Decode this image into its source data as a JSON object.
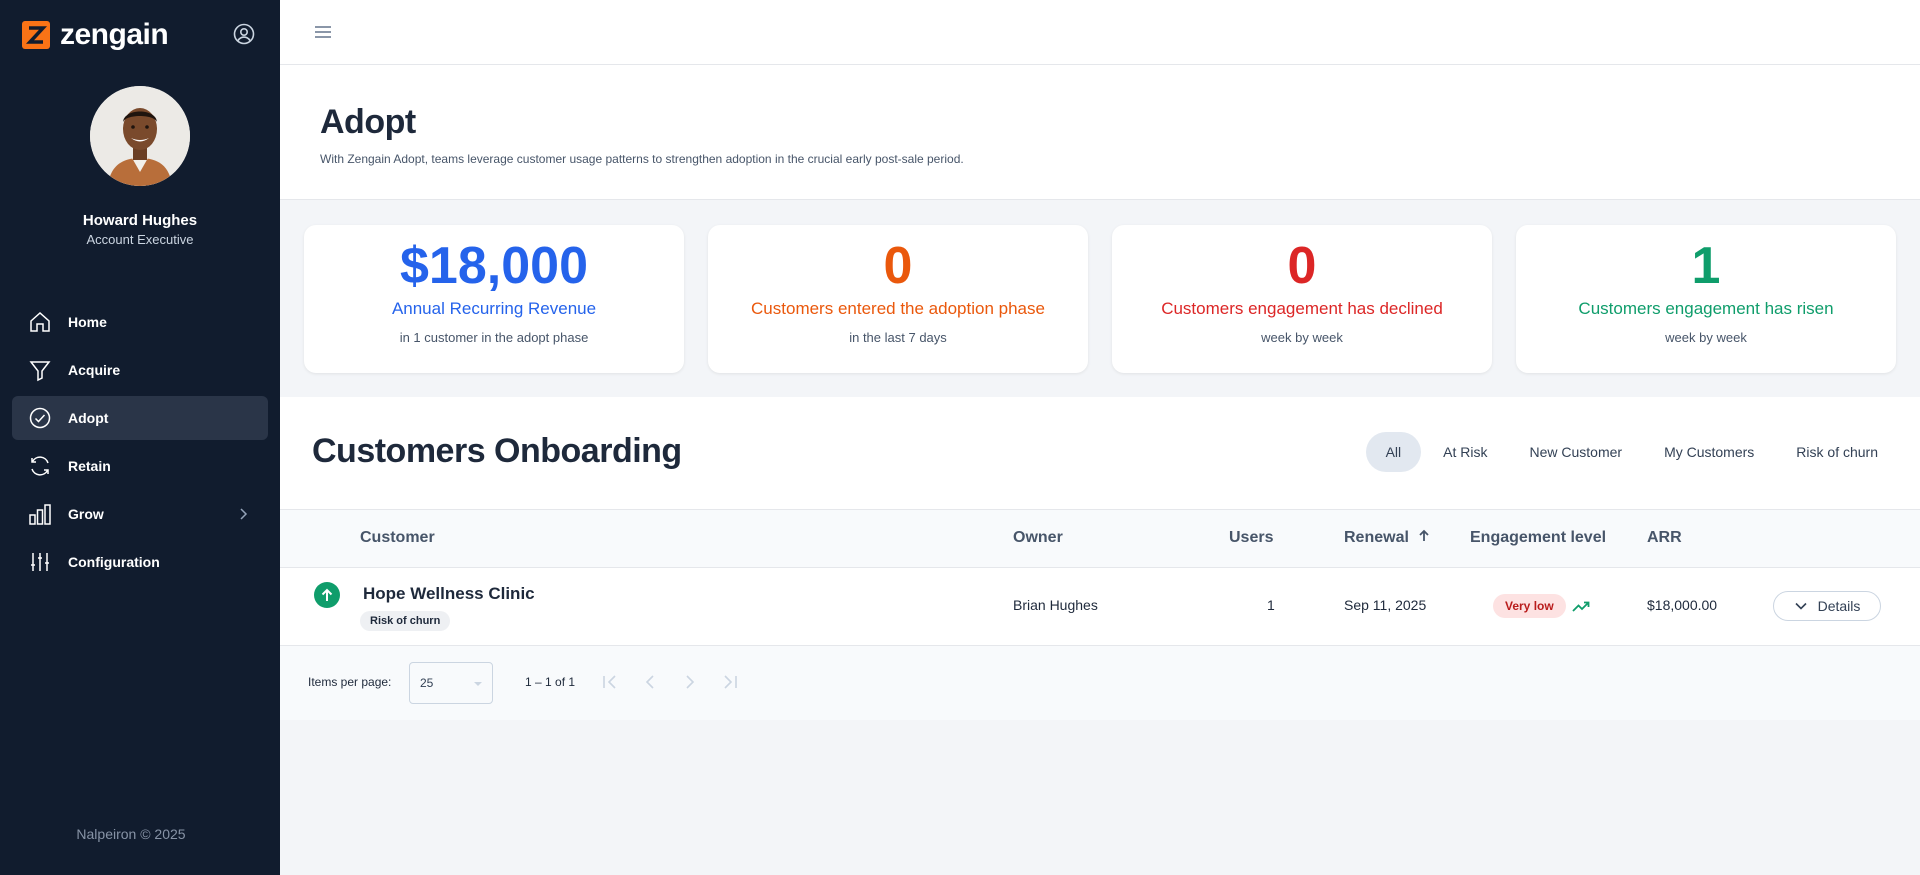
{
  "app": {
    "brand": "zengain"
  },
  "user": {
    "name": "Howard Hughes",
    "role": "Account Executive"
  },
  "nav": [
    {
      "label": "Home",
      "icon": "home-icon",
      "active": false
    },
    {
      "label": "Acquire",
      "icon": "funnel-icon",
      "active": false
    },
    {
      "label": "Adopt",
      "icon": "check-circle-icon",
      "active": true
    },
    {
      "label": "Retain",
      "icon": "refresh-icon",
      "active": false
    },
    {
      "label": "Grow",
      "icon": "bar-chart-icon",
      "active": false
    },
    {
      "label": "Configuration",
      "icon": "sliders-icon",
      "active": false
    }
  ],
  "footer": "Nalpeiron © 2025",
  "page": {
    "title": "Adopt",
    "subtitle": "With Zengain Adopt, teams leverage customer usage patterns to strengthen adoption in the crucial early post-sale period."
  },
  "kpis": [
    {
      "value": "$18,000",
      "label": "Annual Recurring Revenue",
      "sub": "in 1 customer in the adopt phase",
      "value_color": "#2563eb",
      "label_color": "#2563eb"
    },
    {
      "value": "0",
      "label": "Customers entered the adoption phase",
      "sub": "in the last 7 days",
      "value_color": "#ea580c",
      "label_color": "#ea580c"
    },
    {
      "value": "0",
      "label": "Customers engagement has declined",
      "sub": "week by week",
      "value_color": "#dc2626",
      "label_color": "#dc2626"
    },
    {
      "value": "1",
      "label": "Customers engagement has risen",
      "sub": "week by week",
      "value_color": "#0f9d6b",
      "label_color": "#0f9d6b"
    }
  ],
  "onboarding": {
    "title": "Customers Onboarding",
    "filters": [
      {
        "label": "All",
        "active": true
      },
      {
        "label": "At Risk",
        "active": false
      },
      {
        "label": "New Customer",
        "active": false
      },
      {
        "label": "My Customers",
        "active": false
      },
      {
        "label": "Risk of churn",
        "active": false
      }
    ]
  },
  "table": {
    "columns": {
      "customer": "Customer",
      "owner": "Owner",
      "users": "Users",
      "renewal": "Renewal",
      "engagement": "Engagement level",
      "arr": "ARR"
    },
    "rows": [
      {
        "customer": "Hope Wellness Clinic",
        "tag": "Risk of churn",
        "owner": "Brian Hughes",
        "users": "1",
        "renewal": "Sep 11, 2025",
        "engagement": "Very low",
        "arr": "$18,000.00",
        "action": "Details"
      }
    ]
  },
  "pagination": {
    "items_per_page_label": "Items per page:",
    "items_per_page": "25",
    "range": "1 – 1 of 1"
  },
  "colors": {
    "sidebar_bg": "#111c2e",
    "accent_orange": "#f97316",
    "positive": "#0f9d6b"
  }
}
